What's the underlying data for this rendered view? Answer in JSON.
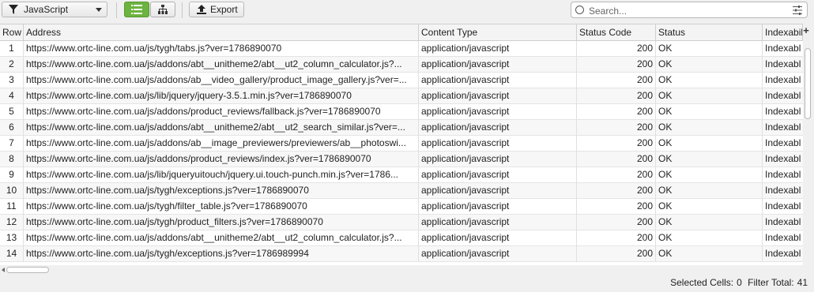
{
  "toolbar": {
    "filter_value": "JavaScript",
    "export_label": "Export",
    "search_placeholder": "Search..."
  },
  "table": {
    "columns": [
      "Row",
      "Address",
      "Content Type",
      "Status Code",
      "Status",
      "Indexabil"
    ],
    "rows": [
      {
        "row": "1",
        "address": "https://www.ortc-line.com.ua/js/tygh/tabs.js?ver=1786890070",
        "content_type": "application/javascript",
        "status_code": "200",
        "status": "OK",
        "indexability": "Indexabl"
      },
      {
        "row": "2",
        "address": "https://www.ortc-line.com.ua/js/addons/abt__unitheme2/abt__ut2_column_calculator.js?...",
        "content_type": "application/javascript",
        "status_code": "200",
        "status": "OK",
        "indexability": "Indexabl"
      },
      {
        "row": "3",
        "address": "https://www.ortc-line.com.ua/js/addons/ab__video_gallery/product_image_gallery.js?ver=...",
        "content_type": "application/javascript",
        "status_code": "200",
        "status": "OK",
        "indexability": "Indexabl"
      },
      {
        "row": "4",
        "address": "https://www.ortc-line.com.ua/js/lib/jquery/jquery-3.5.1.min.js?ver=1786890070",
        "content_type": "application/javascript",
        "status_code": "200",
        "status": "OK",
        "indexability": "Indexabl"
      },
      {
        "row": "5",
        "address": "https://www.ortc-line.com.ua/js/addons/product_reviews/fallback.js?ver=1786890070",
        "content_type": "application/javascript",
        "status_code": "200",
        "status": "OK",
        "indexability": "Indexabl"
      },
      {
        "row": "6",
        "address": "https://www.ortc-line.com.ua/js/addons/abt__unitheme2/abt__ut2_search_similar.js?ver=...",
        "content_type": "application/javascript",
        "status_code": "200",
        "status": "OK",
        "indexability": "Indexabl"
      },
      {
        "row": "7",
        "address": "https://www.ortc-line.com.ua/js/addons/ab__image_previewers/previewers/ab__photoswi...",
        "content_type": "application/javascript",
        "status_code": "200",
        "status": "OK",
        "indexability": "Indexabl"
      },
      {
        "row": "8",
        "address": "https://www.ortc-line.com.ua/js/addons/product_reviews/index.js?ver=1786890070",
        "content_type": "application/javascript",
        "status_code": "200",
        "status": "OK",
        "indexability": "Indexabl"
      },
      {
        "row": "9",
        "address": "https://www.ortc-line.com.ua/js/lib/jqueryuitouch/jquery.ui.touch-punch.min.js?ver=1786...",
        "content_type": "application/javascript",
        "status_code": "200",
        "status": "OK",
        "indexability": "Indexabl"
      },
      {
        "row": "10",
        "address": "https://www.ortc-line.com.ua/js/tygh/exceptions.js?ver=1786890070",
        "content_type": "application/javascript",
        "status_code": "200",
        "status": "OK",
        "indexability": "Indexabl"
      },
      {
        "row": "11",
        "address": "https://www.ortc-line.com.ua/js/tygh/filter_table.js?ver=1786890070",
        "content_type": "application/javascript",
        "status_code": "200",
        "status": "OK",
        "indexability": "Indexabl"
      },
      {
        "row": "12",
        "address": "https://www.ortc-line.com.ua/js/tygh/product_filters.js?ver=1786890070",
        "content_type": "application/javascript",
        "status_code": "200",
        "status": "OK",
        "indexability": "Indexabl"
      },
      {
        "row": "13",
        "address": "https://www.ortc-line.com.ua/js/addons/abt__unitheme2/abt__ut2_column_calculator.js?...",
        "content_type": "application/javascript",
        "status_code": "200",
        "status": "OK",
        "indexability": "Indexabl"
      },
      {
        "row": "14",
        "address": "https://www.ortc-line.com.ua/js/tygh/exceptions.js?ver=1786989994",
        "content_type": "application/javascript",
        "status_code": "200",
        "status": "OK",
        "indexability": "Indexabl"
      }
    ]
  },
  "status_bar": {
    "selected_cells_label": "Selected Cells:",
    "selected_cells_value": "0",
    "filter_total_label": "Filter Total:",
    "filter_total_value": "41"
  },
  "colors": {
    "active_view": "#6cb33f"
  }
}
